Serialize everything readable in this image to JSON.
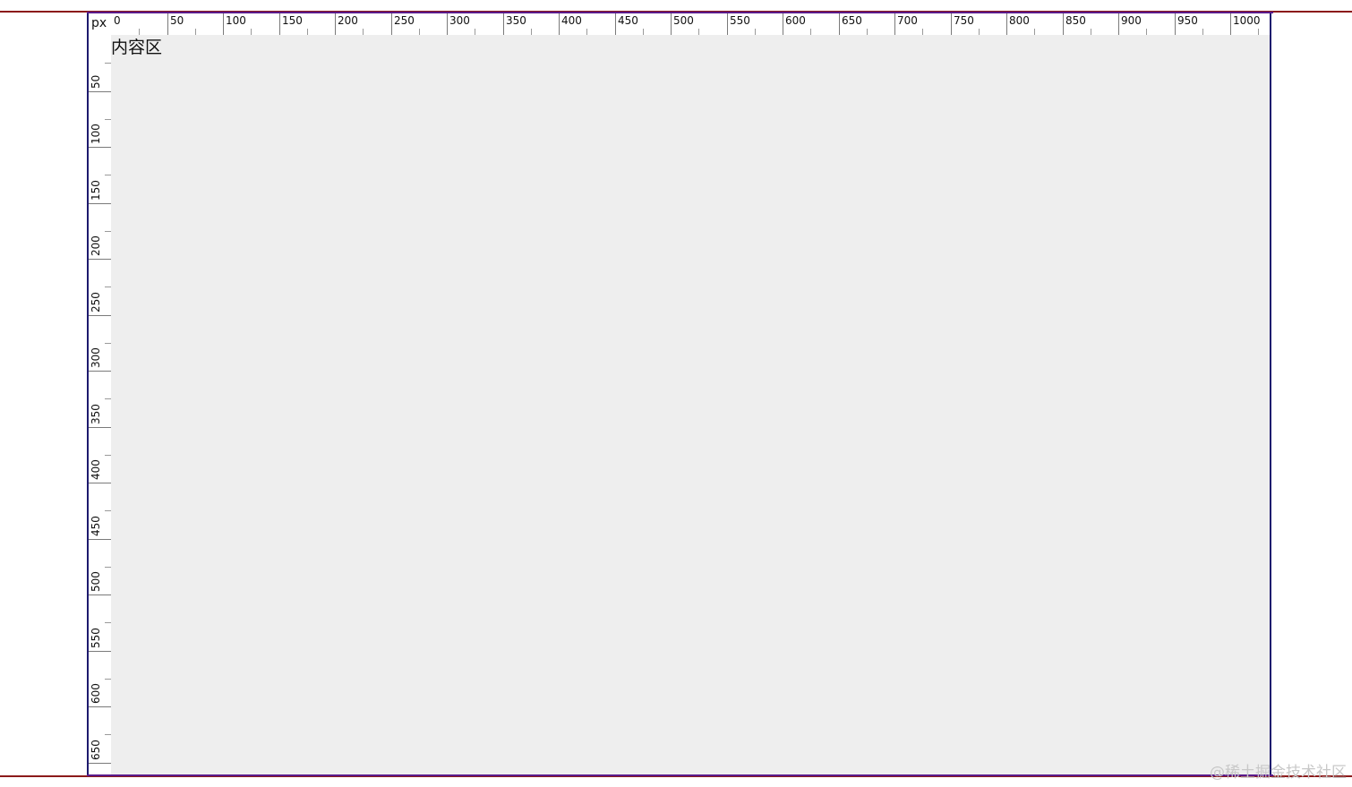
{
  "ruler": {
    "unit": "px",
    "top_labels": [
      "0",
      "50",
      "100",
      "150",
      "200",
      "250",
      "300",
      "350",
      "400",
      "450",
      "500",
      "550",
      "600",
      "650",
      "700",
      "750",
      "800",
      "850",
      "900",
      "950",
      "1000"
    ],
    "left_labels": [
      "50",
      "100",
      "150",
      "200",
      "250",
      "300",
      "350",
      "400",
      "450",
      "500",
      "550",
      "600",
      "650"
    ]
  },
  "content": {
    "label": "内容区"
  },
  "watermark": "@稀土掘金技术社区",
  "colors": {
    "content_background": "#eeeeee",
    "outer_line": "#8b1a1a",
    "container_border": "#1e1a6e",
    "inner_line": "#5a1a8b"
  }
}
